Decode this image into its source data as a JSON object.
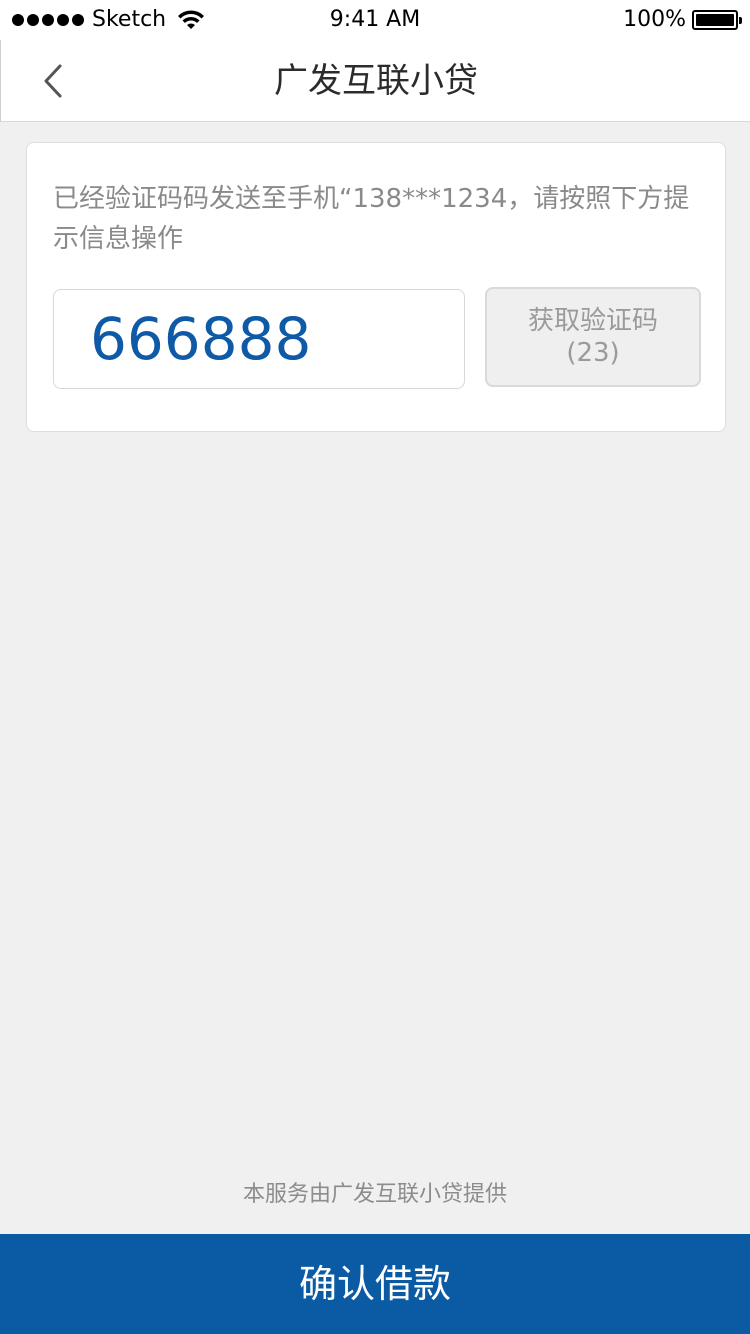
{
  "status_bar": {
    "carrier": "Sketch",
    "time": "9:41 AM",
    "battery": "100%",
    "signal_icon": "signal-dots-icon",
    "wifi_icon": "wifi-icon",
    "battery_icon": "battery-icon"
  },
  "nav": {
    "title": "广发互联小贷",
    "back_icon": "chevron-left-icon"
  },
  "verify": {
    "message": "已经验证码码发送至手机“138***1234，请按照下方提示信息操作",
    "code_value": "666888",
    "get_code_label": "获取验证码",
    "countdown": "(23)"
  },
  "footer": {
    "provider_note": "本服务由广发互联小贷提供",
    "confirm_label": "确认借款"
  },
  "colors": {
    "accent": "#0b5aa4",
    "code_text": "#0e5aa7",
    "background": "#f0f0f0"
  }
}
